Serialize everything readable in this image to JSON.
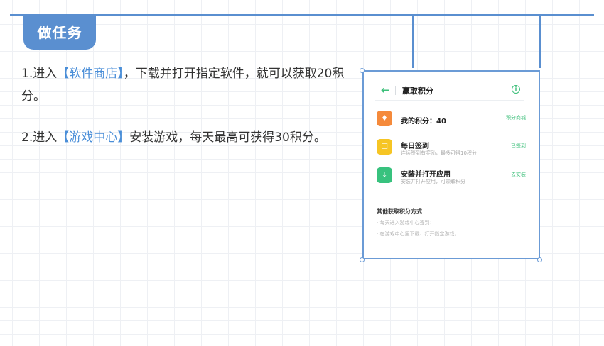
{
  "badge": {
    "label": "做任务"
  },
  "instructions": [
    {
      "prefix": "1.进入",
      "link": "【软件商店】",
      "suffix": "，下载并打开指定软件，就可以获取20积分。"
    },
    {
      "prefix": "2.进入",
      "link": "【游戏中心】",
      "suffix": "安装游戏，每天最高可获得30积分。"
    }
  ],
  "screenshot": {
    "header": {
      "back": "←",
      "title": "赢取积分",
      "info": "i"
    },
    "rows": [
      {
        "icon": "gem-icon",
        "glyph": "♦",
        "title": "我的积分：40",
        "subtitle": "",
        "action": "积分商城"
      },
      {
        "icon": "checkin-icon",
        "glyph": "☐",
        "title": "每日签到",
        "subtitle": "连续签到有奖励，最多可得10积分",
        "action": "已签到"
      },
      {
        "icon": "download-icon",
        "glyph": "⤓",
        "title": "安装并打开应用",
        "subtitle": "安装并打开应用，可领取积分",
        "action": "去安装"
      }
    ],
    "other": {
      "title": "其他获取积分方式",
      "items": [
        "· 每天进入游戏中心签到；",
        "· 在游戏中心里下载、打开指定游戏。"
      ]
    }
  }
}
